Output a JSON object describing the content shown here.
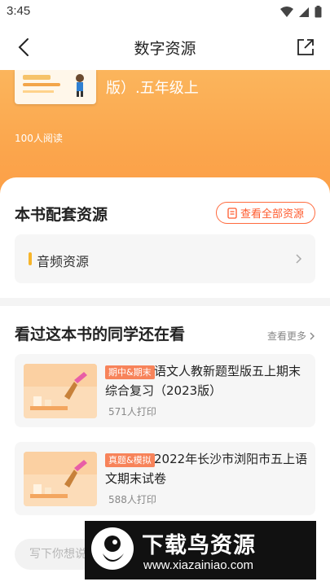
{
  "status_bar": {
    "time": "3:45"
  },
  "nav": {
    "title": "数字资源"
  },
  "hero": {
    "book_title": "版）.五年级上",
    "reads": "100人阅读"
  },
  "resources": {
    "title": "本书配套资源",
    "view_all_label": "查看全部资源",
    "items": [
      {
        "label": "音频资源"
      }
    ]
  },
  "recommend": {
    "title": "看过这本书的同学还在看",
    "more_label": "查看更多",
    "items": [
      {
        "tag": "期中&期末",
        "title": "语文人教新题型版五上期末综合复习（2023版）",
        "prints": "571人打印"
      },
      {
        "tag": "真题&模拟",
        "title": "2022年长沙市浏阳市五上语文期末试卷",
        "prints": "588人打印"
      }
    ]
  },
  "bottom": {
    "input_placeholder": "写下你想说"
  },
  "watermark": {
    "title": "下载鸟资源",
    "url": "www.xiazainiao.com"
  },
  "colors": {
    "accent": "#ff5a2d",
    "hero": "#fba54c",
    "tag": "#f7835a",
    "audio_bar": "#f7b52b"
  }
}
